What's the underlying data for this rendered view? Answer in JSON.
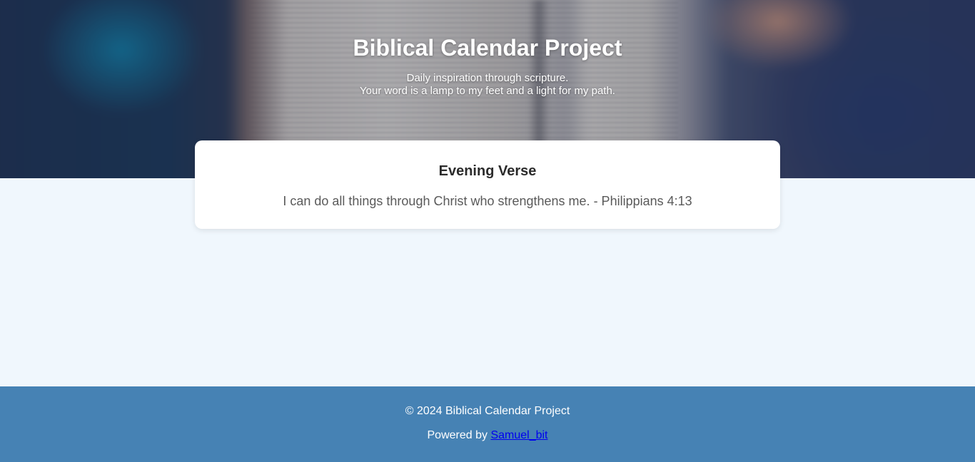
{
  "hero": {
    "title": "Biblical Calendar Project",
    "subtitle_line1": "Daily inspiration through scripture.",
    "subtitle_line2": "Your word is a lamp to my feet and a light for my path."
  },
  "verse_card": {
    "title": "Evening Verse",
    "verse": "I can do all things through Christ who strengthens me. - Philippians 4:13"
  },
  "footer": {
    "copyright": "© 2024 Biblical Calendar Project",
    "powered_prefix": "Powered by",
    "powered_link": "Samuel_bit"
  },
  "colors": {
    "page_background": "#f0f7fd",
    "footer_background": "#4682b4",
    "link": "#0000ee"
  }
}
